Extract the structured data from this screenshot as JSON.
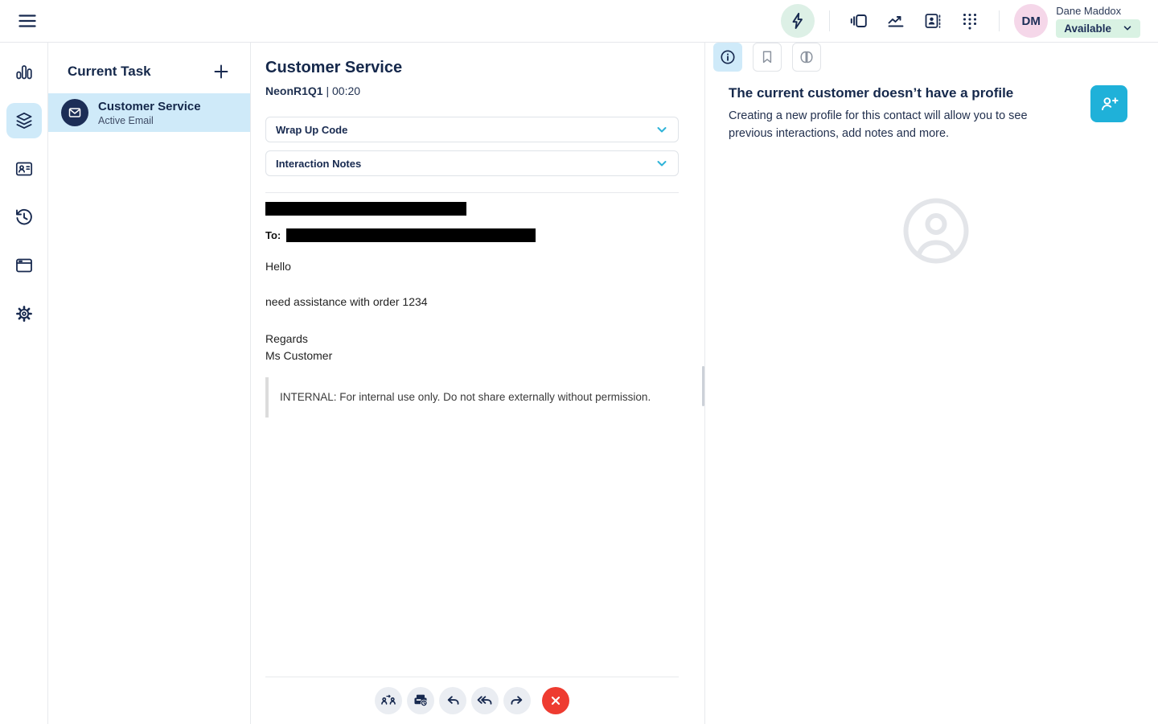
{
  "topbar": {
    "user_name": "Dane Maddox",
    "user_initials": "DM",
    "status": "Available"
  },
  "task_panel": {
    "title": "Current Task",
    "task": {
      "title": "Customer Service",
      "subtitle": "Active Email"
    }
  },
  "main": {
    "title": "Customer Service",
    "queue": "NeonR1Q1",
    "separator": "|",
    "timer": "00:20",
    "accordions": [
      {
        "label": "Wrap Up Code"
      },
      {
        "label": "Interaction Notes"
      }
    ],
    "email": {
      "to_label": "To:",
      "greeting": "Hello",
      "body": "need assistance with order 1234",
      "signoff": "Regards",
      "signature": "Ms Customer",
      "internal_note": "INTERNAL: For internal use only. Do not share externally without permission."
    }
  },
  "right_panel": {
    "no_profile_title": "The current customer doesn’t have a profile",
    "no_profile_description": "Creating a new profile for this contact will allow you to see previous interactions, add notes and more."
  },
  "icons": {
    "hamburger-icon": "three horizontal lines",
    "lightning-icon": "bolt in mint circle",
    "panels-icon": "side panel toggle",
    "performance-icon": "trending line chart",
    "directory-icon": "contact card",
    "dialpad-icon": "grid of dots",
    "bar-chart-icon": "vertical bars",
    "layers-icon": "stacked layers (active)",
    "contact-card-icon": "id card",
    "history-icon": "clock with back arrow",
    "window-icon": "browser window",
    "gear-icon": "settings gear",
    "envelope-icon": "email in navy circle",
    "plus-icon": "add task",
    "chevron-down-icon": "expand accordion",
    "info-icon": "info tab (active)",
    "bookmark-icon": "bookmark tab",
    "brain-icon": "assist tab",
    "person-plus-icon": "create profile",
    "profile-placeholder-icon": "gray person in circle",
    "transfer-icon": "two people",
    "park-email-icon": "inbox with clock",
    "reply-icon": "reply arrow",
    "reply-all-icon": "double reply arrow",
    "forward-icon": "forward arrow",
    "close-icon": "white X in red circle"
  },
  "colors": {
    "navy": "#17294f",
    "selection_blue": "#cfeaf9",
    "accent_teal": "#1fb1d9",
    "chevron_teal": "#2eb3d8",
    "status_green_bg": "#d9f2e3",
    "boost_mint_bg": "#ddf0e6",
    "avatar_pink_bg": "#f5d7e9",
    "danger_red": "#ee3b30",
    "placeholder_gray": "#e3e5e9"
  }
}
